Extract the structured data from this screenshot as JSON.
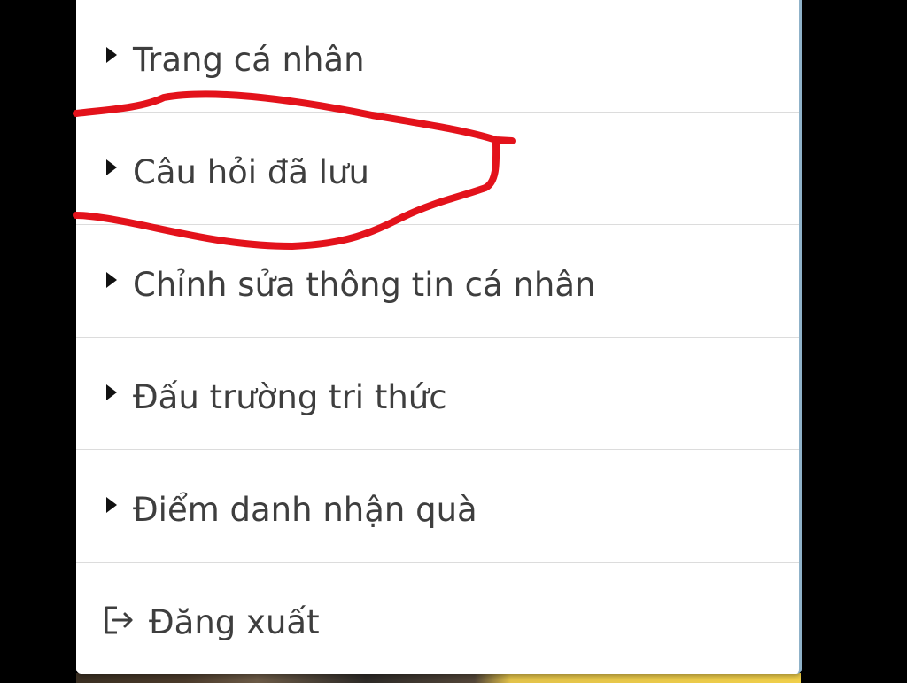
{
  "menu": {
    "items": [
      {
        "label": "Trang cá nhân",
        "icon": "caret-right-icon"
      },
      {
        "label": "Câu hỏi đã lưu",
        "icon": "caret-right-icon"
      },
      {
        "label": "Chỉnh sửa thông tin cá nhân",
        "icon": "caret-right-icon"
      },
      {
        "label": "Đấu trường tri thức",
        "icon": "caret-right-icon"
      },
      {
        "label": "Điểm danh nhận quà",
        "icon": "caret-right-icon"
      },
      {
        "label": "Đăng xuất",
        "icon": "logout-icon"
      }
    ]
  },
  "colors": {
    "annotation": "#e3121b",
    "text": "#3e3e3e",
    "divider": "#dcdcdc",
    "background": "#000000"
  }
}
